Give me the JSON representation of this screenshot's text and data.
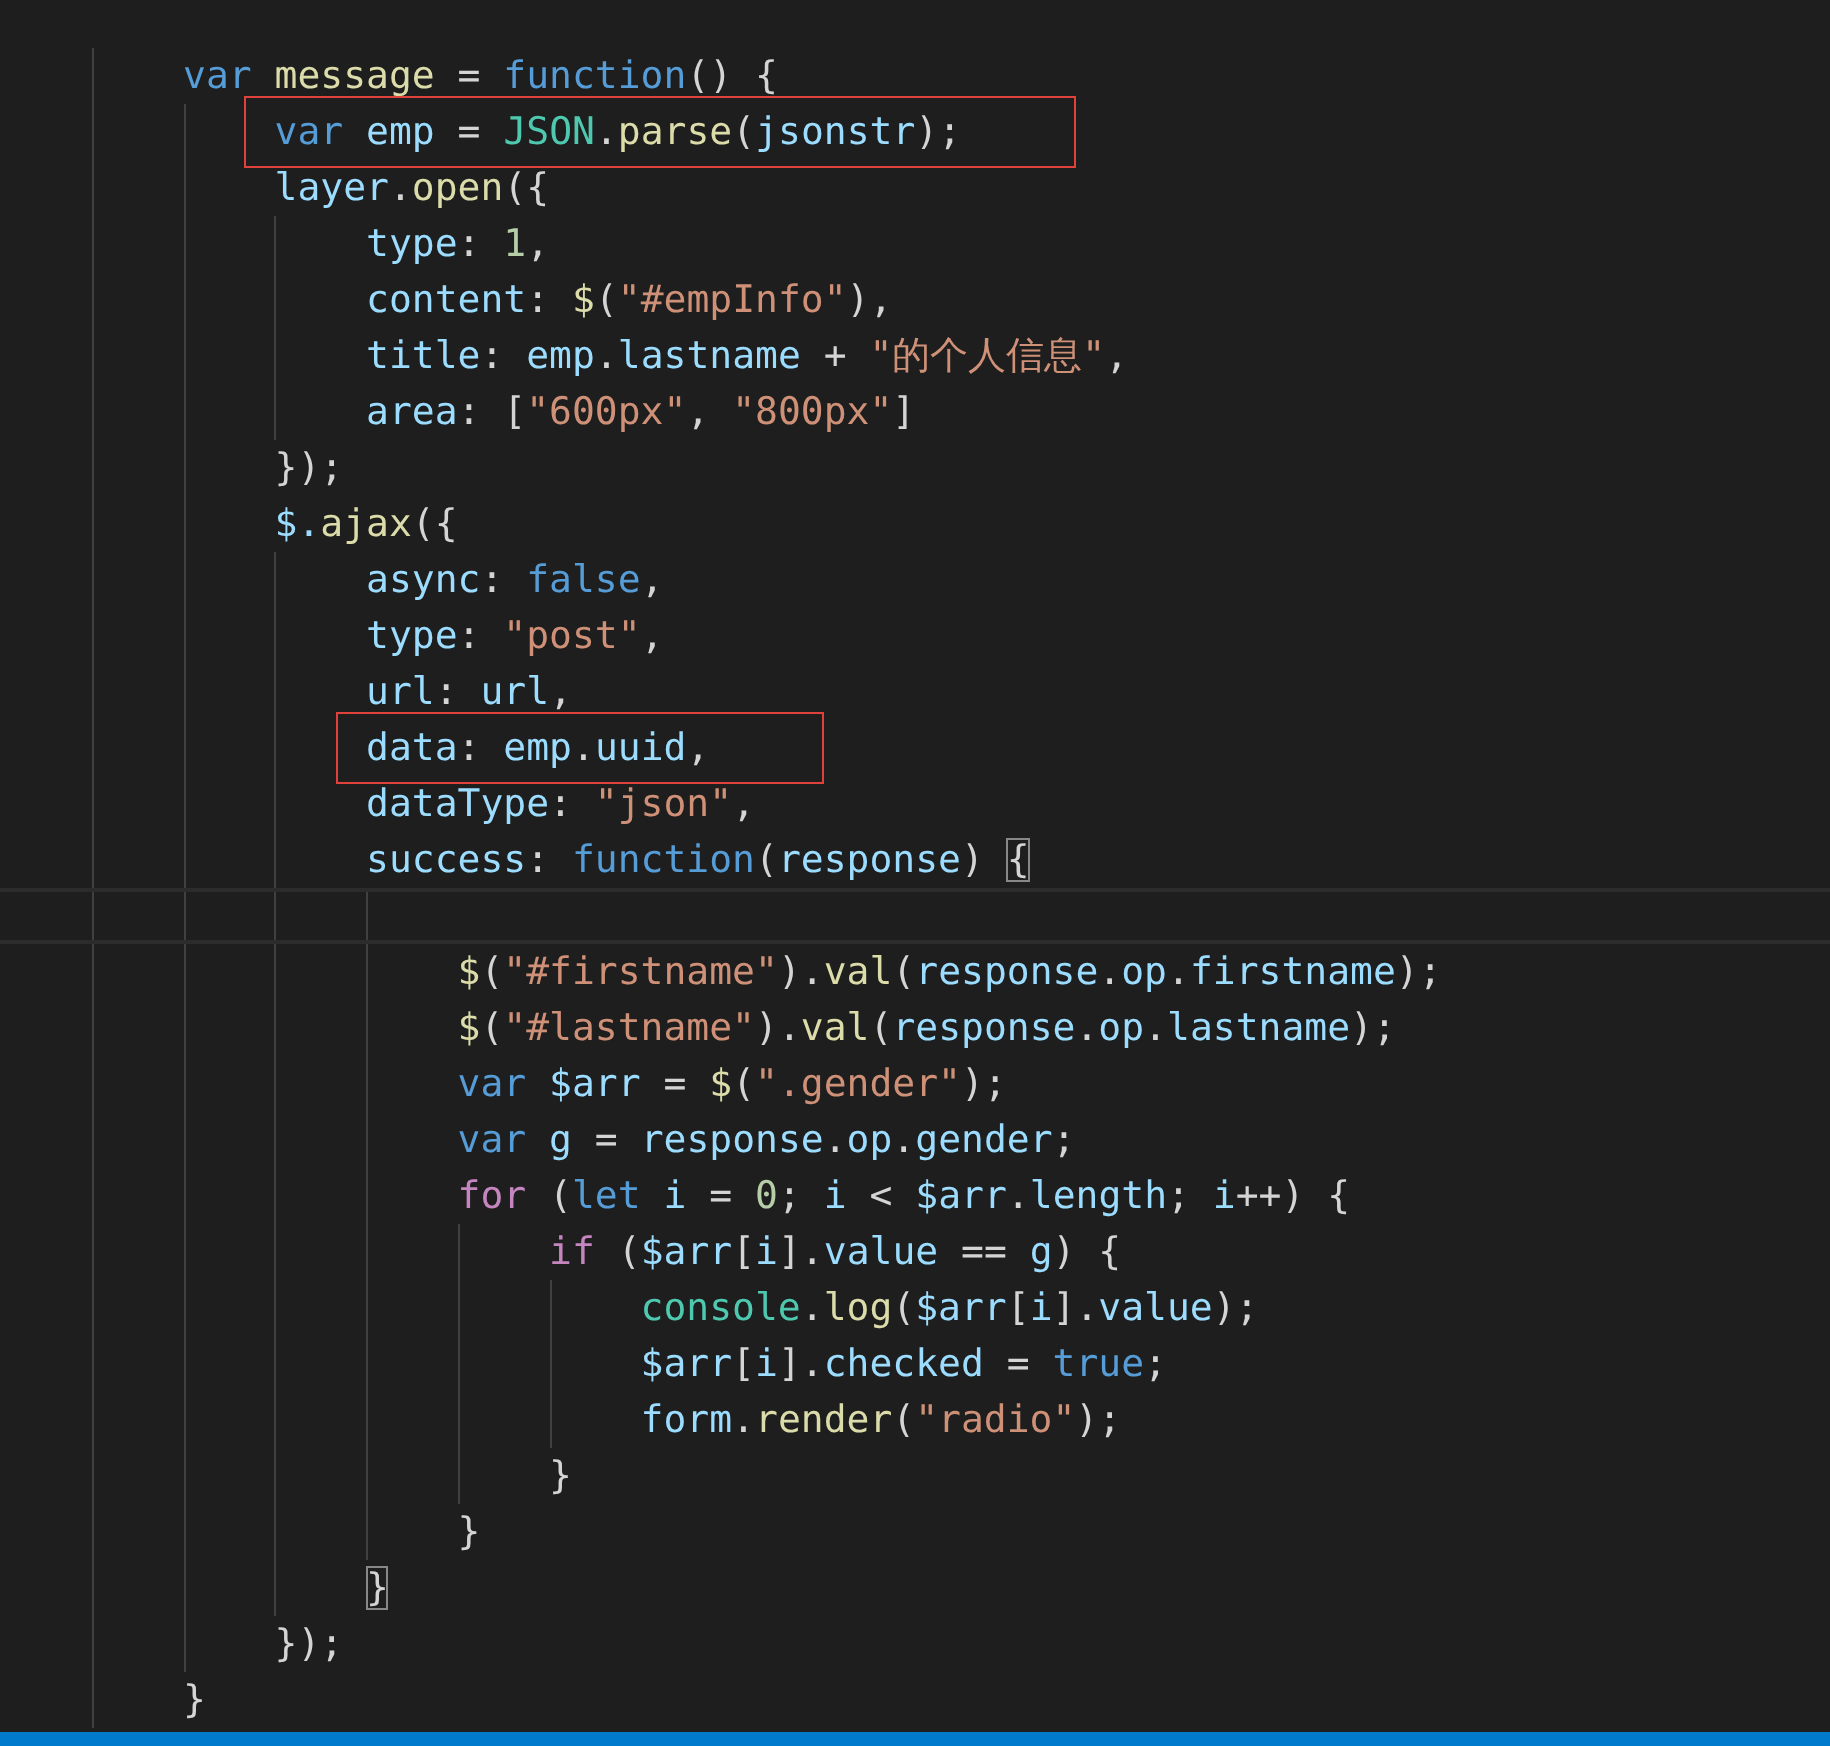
{
  "editor": {
    "lines": [
      {
        "current": false,
        "boxed": false,
        "tokens": [
          {
            "kind": "keyword",
            "text": "        var "
          },
          {
            "kind": "function",
            "text": "message"
          },
          {
            "kind": "plain",
            "text": " = "
          },
          {
            "kind": "keyword",
            "text": "function"
          },
          {
            "kind": "plain",
            "text": "() {"
          }
        ]
      },
      {
        "current": false,
        "boxed": true,
        "tokens": [
          {
            "kind": "keyword",
            "text": "            var "
          },
          {
            "kind": "variable",
            "text": "emp"
          },
          {
            "kind": "plain",
            "text": " = "
          },
          {
            "kind": "type",
            "text": "JSON"
          },
          {
            "kind": "plain",
            "text": "."
          },
          {
            "kind": "function",
            "text": "parse"
          },
          {
            "kind": "plain",
            "text": "("
          },
          {
            "kind": "variable",
            "text": "jsonstr"
          },
          {
            "kind": "plain",
            "text": ");"
          }
        ]
      },
      {
        "current": false,
        "boxed": false,
        "tokens": [
          {
            "kind": "variable",
            "text": "            layer"
          },
          {
            "kind": "plain",
            "text": "."
          },
          {
            "kind": "function",
            "text": "open"
          },
          {
            "kind": "plain",
            "text": "({"
          }
        ]
      },
      {
        "current": false,
        "boxed": false,
        "tokens": [
          {
            "kind": "variable",
            "text": "                type"
          },
          {
            "kind": "plain",
            "text": ": "
          },
          {
            "kind": "number",
            "text": "1"
          },
          {
            "kind": "plain",
            "text": ","
          }
        ]
      },
      {
        "current": false,
        "boxed": false,
        "tokens": [
          {
            "kind": "variable",
            "text": "                content"
          },
          {
            "kind": "plain",
            "text": ": "
          },
          {
            "kind": "function",
            "text": "$"
          },
          {
            "kind": "plain",
            "text": "("
          },
          {
            "kind": "string",
            "text": "\"#empInfo\""
          },
          {
            "kind": "plain",
            "text": "),"
          }
        ]
      },
      {
        "current": false,
        "boxed": false,
        "tokens": [
          {
            "kind": "variable",
            "text": "                title"
          },
          {
            "kind": "plain",
            "text": ": "
          },
          {
            "kind": "variable",
            "text": "emp"
          },
          {
            "kind": "plain",
            "text": "."
          },
          {
            "kind": "variable",
            "text": "lastname"
          },
          {
            "kind": "plain",
            "text": " + "
          },
          {
            "kind": "string",
            "text": "\"的个人信息\""
          },
          {
            "kind": "plain",
            "text": ","
          }
        ]
      },
      {
        "current": false,
        "boxed": false,
        "tokens": [
          {
            "kind": "variable",
            "text": "                area"
          },
          {
            "kind": "plain",
            "text": ": ["
          },
          {
            "kind": "string",
            "text": "\"600px\""
          },
          {
            "kind": "plain",
            "text": ", "
          },
          {
            "kind": "string",
            "text": "\"800px\""
          },
          {
            "kind": "plain",
            "text": "]"
          }
        ]
      },
      {
        "current": false,
        "boxed": false,
        "tokens": [
          {
            "kind": "plain",
            "text": "            });"
          }
        ]
      },
      {
        "current": false,
        "boxed": false,
        "tokens": [
          {
            "kind": "variable",
            "text": "            $."
          },
          {
            "kind": "function",
            "text": "ajax"
          },
          {
            "kind": "plain",
            "text": "({"
          }
        ]
      },
      {
        "current": false,
        "boxed": false,
        "tokens": [
          {
            "kind": "variable",
            "text": "                async"
          },
          {
            "kind": "plain",
            "text": ": "
          },
          {
            "kind": "keyword",
            "text": "false"
          },
          {
            "kind": "plain",
            "text": ","
          }
        ]
      },
      {
        "current": false,
        "boxed": false,
        "tokens": [
          {
            "kind": "variable",
            "text": "                type"
          },
          {
            "kind": "plain",
            "text": ": "
          },
          {
            "kind": "string",
            "text": "\"post\""
          },
          {
            "kind": "plain",
            "text": ","
          }
        ]
      },
      {
        "current": false,
        "boxed": false,
        "tokens": [
          {
            "kind": "variable",
            "text": "                url"
          },
          {
            "kind": "plain",
            "text": ": "
          },
          {
            "kind": "variable",
            "text": "url"
          },
          {
            "kind": "plain",
            "text": ","
          }
        ]
      },
      {
        "current": false,
        "boxed": true,
        "tokens": [
          {
            "kind": "variable",
            "text": "                data"
          },
          {
            "kind": "plain",
            "text": ": "
          },
          {
            "kind": "variable",
            "text": "emp"
          },
          {
            "kind": "plain",
            "text": "."
          },
          {
            "kind": "variable",
            "text": "uuid"
          },
          {
            "kind": "plain",
            "text": ","
          }
        ]
      },
      {
        "current": false,
        "boxed": false,
        "tokens": [
          {
            "kind": "variable",
            "text": "                dataType"
          },
          {
            "kind": "plain",
            "text": ": "
          },
          {
            "kind": "string",
            "text": "\"json\""
          },
          {
            "kind": "plain",
            "text": ","
          }
        ]
      },
      {
        "current": false,
        "boxed": false,
        "tokens": [
          {
            "kind": "variable",
            "text": "                success"
          },
          {
            "kind": "plain",
            "text": ": "
          },
          {
            "kind": "keyword",
            "text": "function"
          },
          {
            "kind": "plain",
            "text": "("
          },
          {
            "kind": "variable",
            "text": "response"
          },
          {
            "kind": "plain",
            "text": ") "
          },
          {
            "kind": "plain",
            "text": "{",
            "matched": true
          }
        ]
      },
      {
        "current": true,
        "boxed": false
      },
      {
        "current": false,
        "boxed": false,
        "tokens": [
          {
            "kind": "function",
            "text": "                    $"
          },
          {
            "kind": "plain",
            "text": "("
          },
          {
            "kind": "string",
            "text": "\"#firstname\""
          },
          {
            "kind": "plain",
            "text": ")."
          },
          {
            "kind": "function",
            "text": "val"
          },
          {
            "kind": "plain",
            "text": "("
          },
          {
            "kind": "variable",
            "text": "response"
          },
          {
            "kind": "plain",
            "text": "."
          },
          {
            "kind": "variable",
            "text": "op"
          },
          {
            "kind": "plain",
            "text": "."
          },
          {
            "kind": "variable",
            "text": "firstname"
          },
          {
            "kind": "plain",
            "text": ");"
          }
        ]
      },
      {
        "current": false,
        "boxed": false,
        "tokens": [
          {
            "kind": "function",
            "text": "                    $"
          },
          {
            "kind": "plain",
            "text": "("
          },
          {
            "kind": "string",
            "text": "\"#lastname\""
          },
          {
            "kind": "plain",
            "text": ")."
          },
          {
            "kind": "function",
            "text": "val"
          },
          {
            "kind": "plain",
            "text": "("
          },
          {
            "kind": "variable",
            "text": "response"
          },
          {
            "kind": "plain",
            "text": "."
          },
          {
            "kind": "variable",
            "text": "op"
          },
          {
            "kind": "plain",
            "text": "."
          },
          {
            "kind": "variable",
            "text": "lastname"
          },
          {
            "kind": "plain",
            "text": ");"
          }
        ]
      },
      {
        "current": false,
        "boxed": false,
        "tokens": [
          {
            "kind": "keyword",
            "text": "                    var "
          },
          {
            "kind": "variable",
            "text": "$arr"
          },
          {
            "kind": "plain",
            "text": " = "
          },
          {
            "kind": "function",
            "text": "$"
          },
          {
            "kind": "plain",
            "text": "("
          },
          {
            "kind": "string",
            "text": "\".gender\""
          },
          {
            "kind": "plain",
            "text": ");"
          }
        ]
      },
      {
        "current": false,
        "boxed": false,
        "tokens": [
          {
            "kind": "keyword",
            "text": "                    var "
          },
          {
            "kind": "variable",
            "text": "g"
          },
          {
            "kind": "plain",
            "text": " = "
          },
          {
            "kind": "variable",
            "text": "response"
          },
          {
            "kind": "plain",
            "text": "."
          },
          {
            "kind": "variable",
            "text": "op"
          },
          {
            "kind": "plain",
            "text": "."
          },
          {
            "kind": "variable",
            "text": "gender"
          },
          {
            "kind": "plain",
            "text": ";"
          }
        ]
      },
      {
        "current": false,
        "boxed": false,
        "tokens": [
          {
            "kind": "control",
            "text": "                    for"
          },
          {
            "kind": "plain",
            "text": " ("
          },
          {
            "kind": "keyword",
            "text": "let "
          },
          {
            "kind": "variable",
            "text": "i"
          },
          {
            "kind": "plain",
            "text": " = "
          },
          {
            "kind": "number",
            "text": "0"
          },
          {
            "kind": "plain",
            "text": "; "
          },
          {
            "kind": "variable",
            "text": "i"
          },
          {
            "kind": "plain",
            "text": " < "
          },
          {
            "kind": "variable",
            "text": "$arr"
          },
          {
            "kind": "plain",
            "text": "."
          },
          {
            "kind": "variable",
            "text": "length"
          },
          {
            "kind": "plain",
            "text": "; "
          },
          {
            "kind": "variable",
            "text": "i"
          },
          {
            "kind": "plain",
            "text": "++) {"
          }
        ]
      },
      {
        "current": false,
        "boxed": false,
        "tokens": [
          {
            "kind": "control",
            "text": "                        if"
          },
          {
            "kind": "plain",
            "text": " ("
          },
          {
            "kind": "variable",
            "text": "$arr"
          },
          {
            "kind": "plain",
            "text": "["
          },
          {
            "kind": "variable",
            "text": "i"
          },
          {
            "kind": "plain",
            "text": "]."
          },
          {
            "kind": "variable",
            "text": "value"
          },
          {
            "kind": "plain",
            "text": " == "
          },
          {
            "kind": "variable",
            "text": "g"
          },
          {
            "kind": "plain",
            "text": ") {"
          }
        ]
      },
      {
        "current": false,
        "boxed": false,
        "tokens": [
          {
            "kind": "type",
            "text": "                            console"
          },
          {
            "kind": "plain",
            "text": "."
          },
          {
            "kind": "function",
            "text": "log"
          },
          {
            "kind": "plain",
            "text": "("
          },
          {
            "kind": "variable",
            "text": "$arr"
          },
          {
            "kind": "plain",
            "text": "["
          },
          {
            "kind": "variable",
            "text": "i"
          },
          {
            "kind": "plain",
            "text": "]."
          },
          {
            "kind": "variable",
            "text": "value"
          },
          {
            "kind": "plain",
            "text": ");"
          }
        ]
      },
      {
        "current": false,
        "boxed": false,
        "tokens": [
          {
            "kind": "variable",
            "text": "                            $arr"
          },
          {
            "kind": "plain",
            "text": "["
          },
          {
            "kind": "variable",
            "text": "i"
          },
          {
            "kind": "plain",
            "text": "]."
          },
          {
            "kind": "variable",
            "text": "checked"
          },
          {
            "kind": "plain",
            "text": " = "
          },
          {
            "kind": "keyword",
            "text": "true"
          },
          {
            "kind": "plain",
            "text": ";"
          }
        ]
      },
      {
        "current": false,
        "boxed": false,
        "tokens": [
          {
            "kind": "variable",
            "text": "                            form"
          },
          {
            "kind": "plain",
            "text": "."
          },
          {
            "kind": "function",
            "text": "render"
          },
          {
            "kind": "plain",
            "text": "("
          },
          {
            "kind": "string",
            "text": "\"radio\""
          },
          {
            "kind": "plain",
            "text": ");"
          }
        ]
      },
      {
        "current": false,
        "boxed": false,
        "tokens": [
          {
            "kind": "plain",
            "text": "                        }"
          }
        ]
      },
      {
        "current": false,
        "boxed": false,
        "tokens": [
          {
            "kind": "plain",
            "text": "                    }"
          }
        ]
      },
      {
        "current": false,
        "boxed": false,
        "tokens": [
          {
            "kind": "plain",
            "text": "                }",
            "matched": true
          }
        ]
      },
      {
        "current": false,
        "boxed": false,
        "tokens": [
          {
            "kind": "plain",
            "text": "            });"
          }
        ]
      },
      {
        "current": false,
        "boxed": false,
        "tokens": [
          {
            "kind": "plain",
            "text": "        }"
          }
        ]
      }
    ]
  }
}
